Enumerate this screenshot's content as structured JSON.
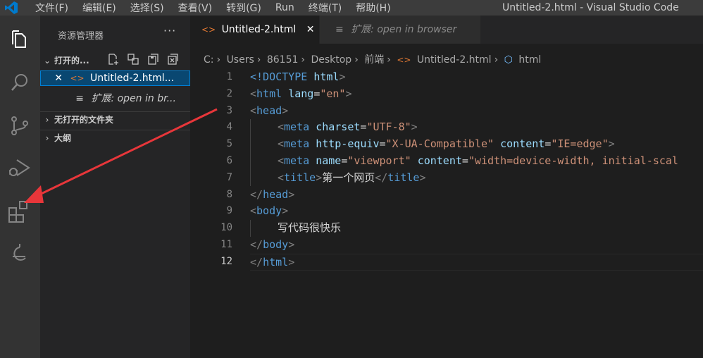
{
  "title_bar": {
    "menus": [
      "文件(F)",
      "编辑(E)",
      "选择(S)",
      "查看(V)",
      "转到(G)",
      "Run",
      "终端(T)",
      "帮助(H)"
    ],
    "window_title": "Untitled-2.html - Visual Studio Code"
  },
  "activity_bar": {
    "icons": [
      "explorer-icon",
      "search-icon",
      "source-control-icon",
      "run-debug-icon",
      "extensions-icon",
      "remote-explorer-icon"
    ]
  },
  "sidebar": {
    "title": "资源管理器",
    "more": "···",
    "open_editors": {
      "label": "打开的...",
      "items": [
        {
          "label": "Untitled-2.html...",
          "close": "✕"
        },
        {
          "label": "扩展: open in br..."
        }
      ]
    },
    "no_folder_label": "无打开的文件夹",
    "outline_label": "大纲"
  },
  "tabs": [
    {
      "label": "Untitled-2.html",
      "close": "✕"
    },
    {
      "label": "扩展: open in browser"
    }
  ],
  "breadcrumb": [
    "C:",
    "Users",
    "86151",
    "Desktop",
    "前端",
    "Untitled-2.html",
    "html"
  ],
  "editor": {
    "line_numbers": [
      "1",
      "2",
      "3",
      "4",
      "5",
      "6",
      "7",
      "8",
      "9",
      "10",
      "11",
      "12"
    ],
    "current_line": "12",
    "lines": {
      "l1": {
        "t1": "<!DOCTYPE",
        "t2": "html",
        "t3": ">"
      },
      "l2": {
        "t1": "<",
        "t2": "html",
        "t3": "lang",
        "t4": "=",
        "t5": "\"en\"",
        "t6": ">"
      },
      "l3": {
        "t1": "<",
        "t2": "head",
        "t3": ">"
      },
      "l4": {
        "t1": "<",
        "t2": "meta",
        "t3": "charset",
        "t4": "=",
        "t5": "\"UTF-8\"",
        "t6": ">"
      },
      "l5": {
        "t1": "<",
        "t2": "meta",
        "t3": "http-equiv",
        "t4": "=",
        "t5": "\"X-UA-Compatible\"",
        "t6": "content",
        "t7": "=",
        "t8": "\"IE=edge\"",
        "t9": ">"
      },
      "l6": {
        "t1": "<",
        "t2": "meta",
        "t3": "name",
        "t4": "=",
        "t5": "\"viewport\"",
        "t6": "content",
        "t7": "=",
        "t8": "\"width=device-width, initial-scal"
      },
      "l7": {
        "t1": "<",
        "t2": "title",
        "t3": ">",
        "t4": "第一个网页",
        "t5": "</",
        "t6": "title",
        "t7": ">"
      },
      "l8": {
        "t1": "</",
        "t2": "head",
        "t3": ">"
      },
      "l9": {
        "t1": "<",
        "t2": "body",
        "t3": ">"
      },
      "l10": {
        "t1": "写代码很快乐"
      },
      "l11": {
        "t1": "</",
        "t2": "body",
        "t3": ">"
      },
      "l12": {
        "t1": "</",
        "t2": "html",
        "t3": ">"
      }
    }
  },
  "colors": {
    "tag": "#569cd6",
    "attribute": "#9cdcfe",
    "string": "#ce9178",
    "annotation_arrow": "#e8363a",
    "vscode_blue": "#007acc"
  }
}
